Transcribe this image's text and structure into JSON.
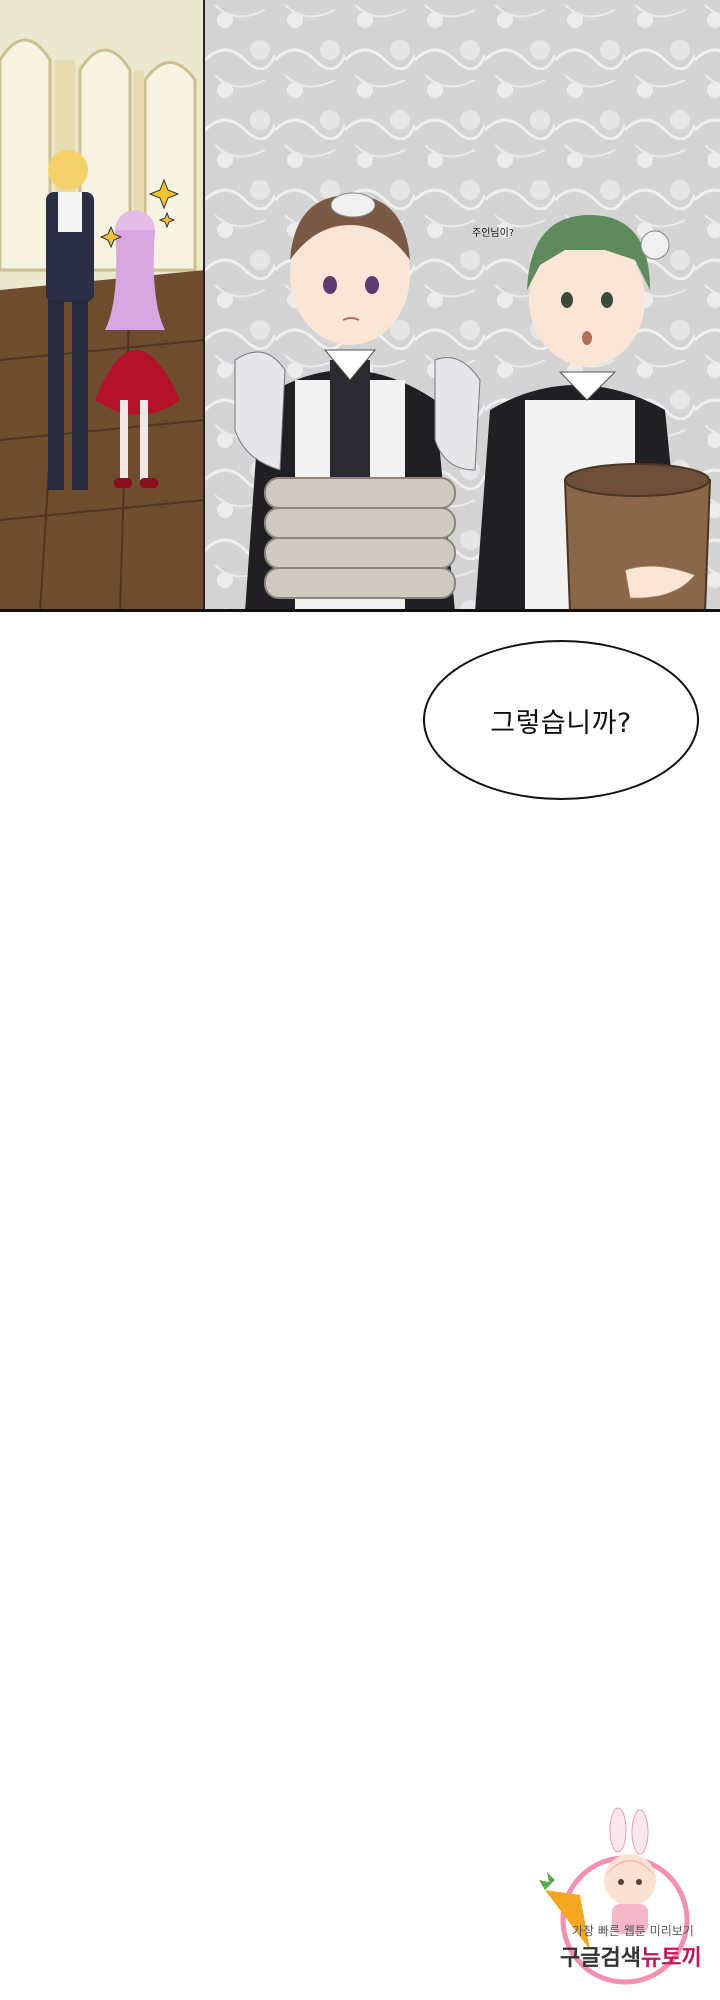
{
  "panel": {
    "speech_small": "주인님이?"
  },
  "dialogue": {
    "bubble_text": "그렇습니까?"
  },
  "watermark": {
    "tagline": "가장 빠른 웹툰 미리보기",
    "brand_prefix": "구글검색",
    "brand_name": "뉴토끼"
  },
  "colors": {
    "accent_pink": "#c2185b",
    "dress_red": "#b3122a",
    "maid_black": "#1f1f24"
  }
}
